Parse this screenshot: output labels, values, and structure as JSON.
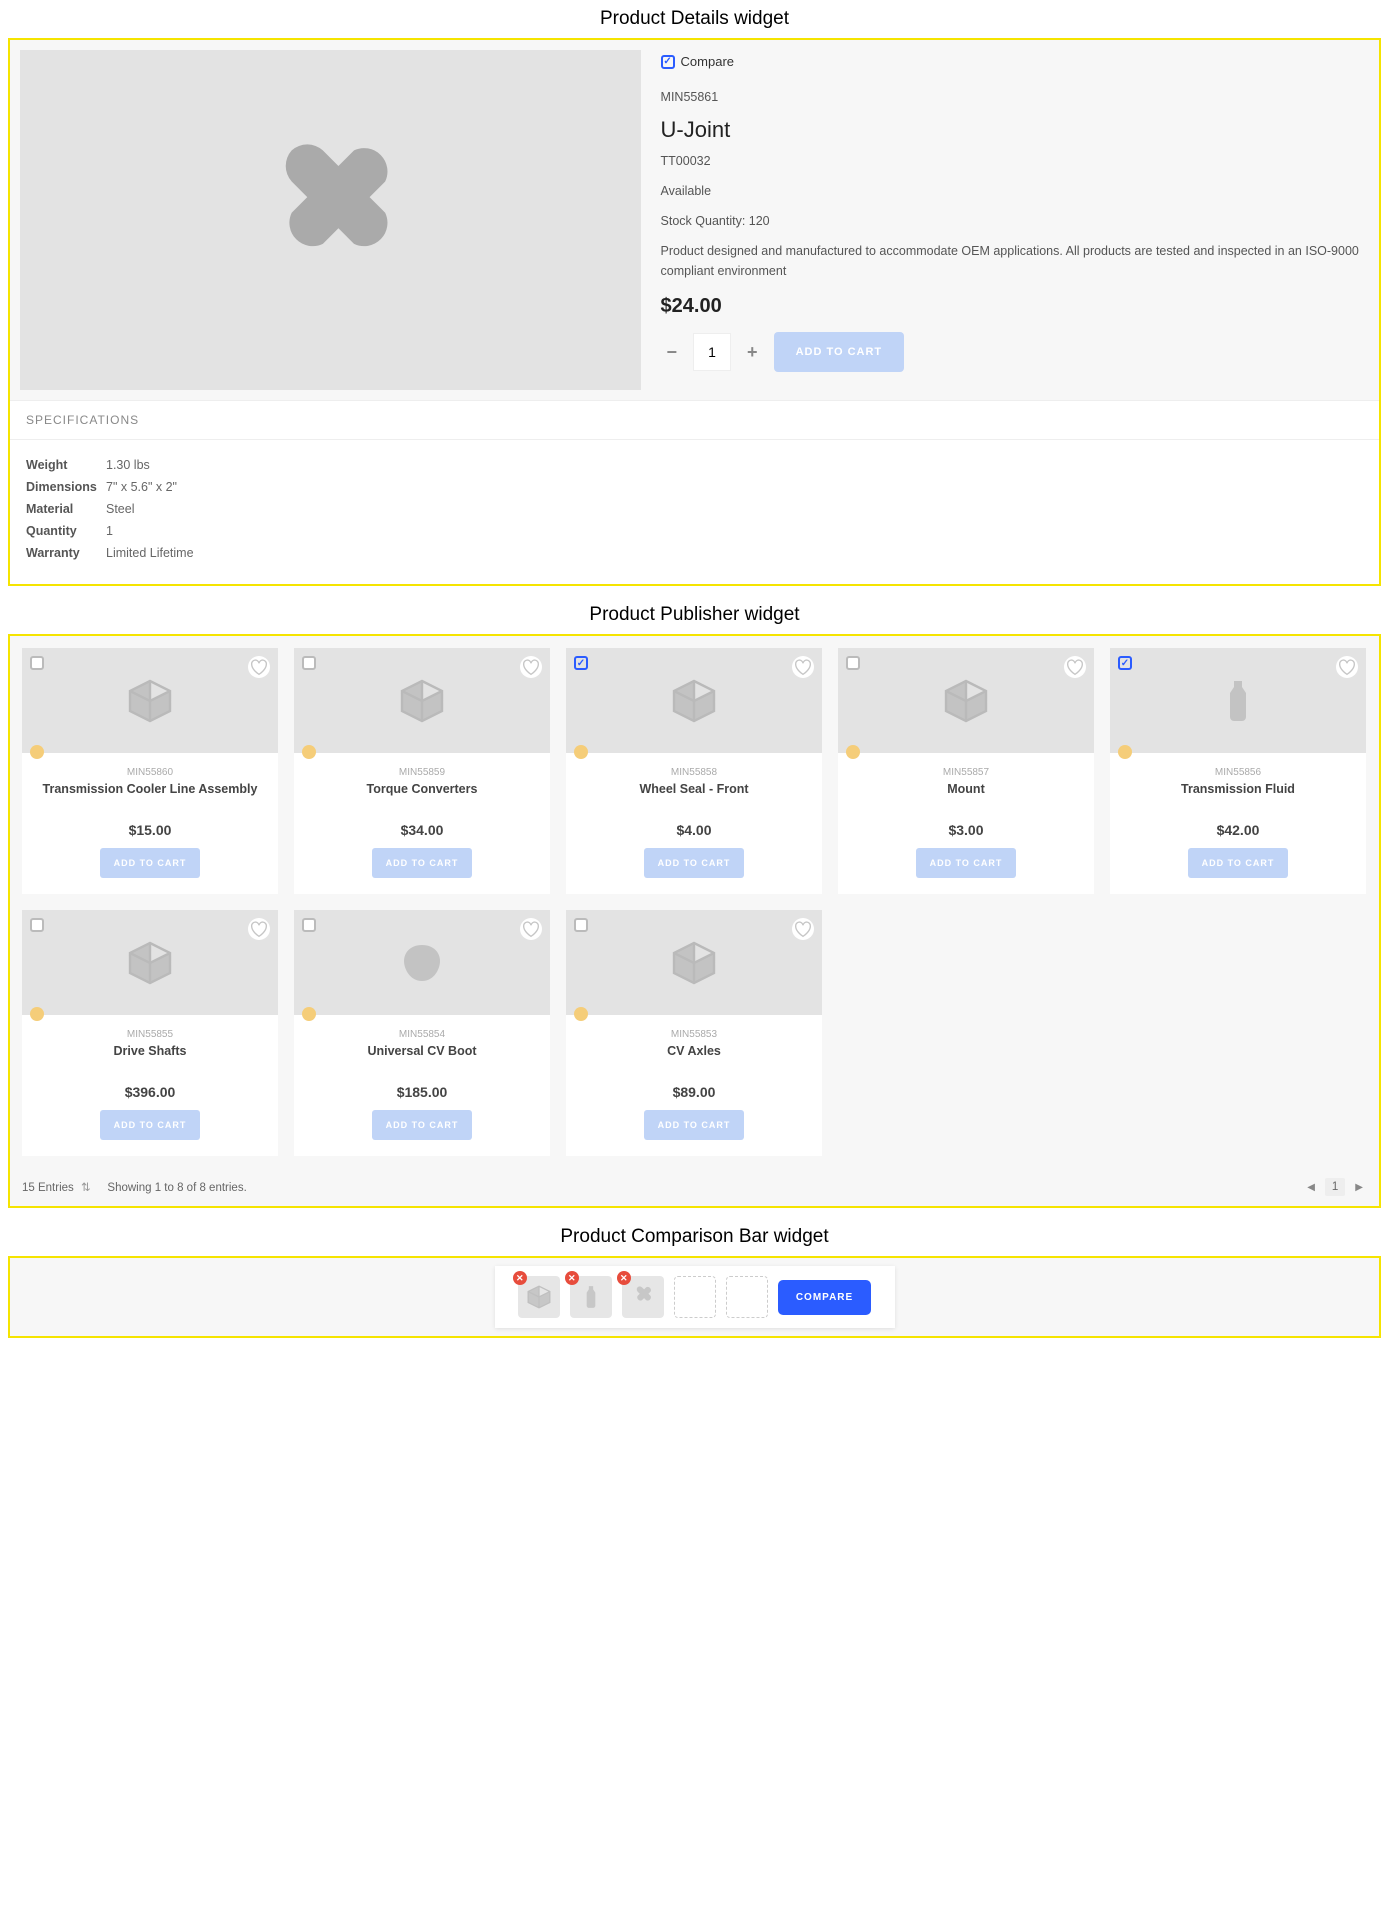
{
  "labels": {
    "details_widget": "Product Details widget",
    "publisher_widget": "Product Publisher widget",
    "comparison_widget": "Product Comparison Bar widget",
    "compare": "Compare",
    "specifications_tab": "SPECIFICATIONS",
    "add_to_cart": "ADD TO CART",
    "compare_btn": "COMPARE"
  },
  "product": {
    "sku": "MIN55861",
    "name": "U-Joint",
    "tt": "TT00032",
    "availability": "Available",
    "stock": "Stock Quantity: 120",
    "description": "Product designed and manufactured to accommodate OEM applications. All products are tested and inspected in an ISO-9000 compliant environment",
    "price": "$24.00",
    "qty": "1"
  },
  "specs": [
    {
      "k": "Weight",
      "v": "1.30 lbs"
    },
    {
      "k": "Dimensions",
      "v": "7\" x 5.6\" x 2\""
    },
    {
      "k": "Material",
      "v": "Steel"
    },
    {
      "k": "Quantity",
      "v": "1"
    },
    {
      "k": "Warranty",
      "v": "Limited Lifetime"
    }
  ],
  "cards": [
    {
      "sku": "MIN55860",
      "name": "Transmission Cooler Line Assembly",
      "price": "$15.00",
      "checked": false,
      "icon": "cube"
    },
    {
      "sku": "MIN55859",
      "name": "Torque Converters",
      "price": "$34.00",
      "checked": false,
      "icon": "cube"
    },
    {
      "sku": "MIN55858",
      "name": "Wheel Seal - Front",
      "price": "$4.00",
      "checked": true,
      "icon": "cube"
    },
    {
      "sku": "MIN55857",
      "name": "Mount",
      "price": "$3.00",
      "checked": false,
      "icon": "cube"
    },
    {
      "sku": "MIN55856",
      "name": "Transmission Fluid",
      "price": "$42.00",
      "checked": true,
      "icon": "bottle"
    },
    {
      "sku": "MIN55855",
      "name": "Drive Shafts",
      "price": "$396.00",
      "checked": false,
      "icon": "cube"
    },
    {
      "sku": "MIN55854",
      "name": "Universal CV Boot",
      "price": "$185.00",
      "checked": false,
      "icon": "blob"
    },
    {
      "sku": "MIN55853",
      "name": "CV Axles",
      "price": "$89.00",
      "checked": false,
      "icon": "cube"
    }
  ],
  "pager": {
    "entries_select": "15 Entries",
    "showing": "Showing 1 to 8 of 8 entries.",
    "page": "1"
  },
  "comparison_slots": [
    {
      "filled": true,
      "icon": "cube"
    },
    {
      "filled": true,
      "icon": "bottle"
    },
    {
      "filled": true,
      "icon": "ujoint"
    },
    {
      "filled": false
    },
    {
      "filled": false
    }
  ]
}
